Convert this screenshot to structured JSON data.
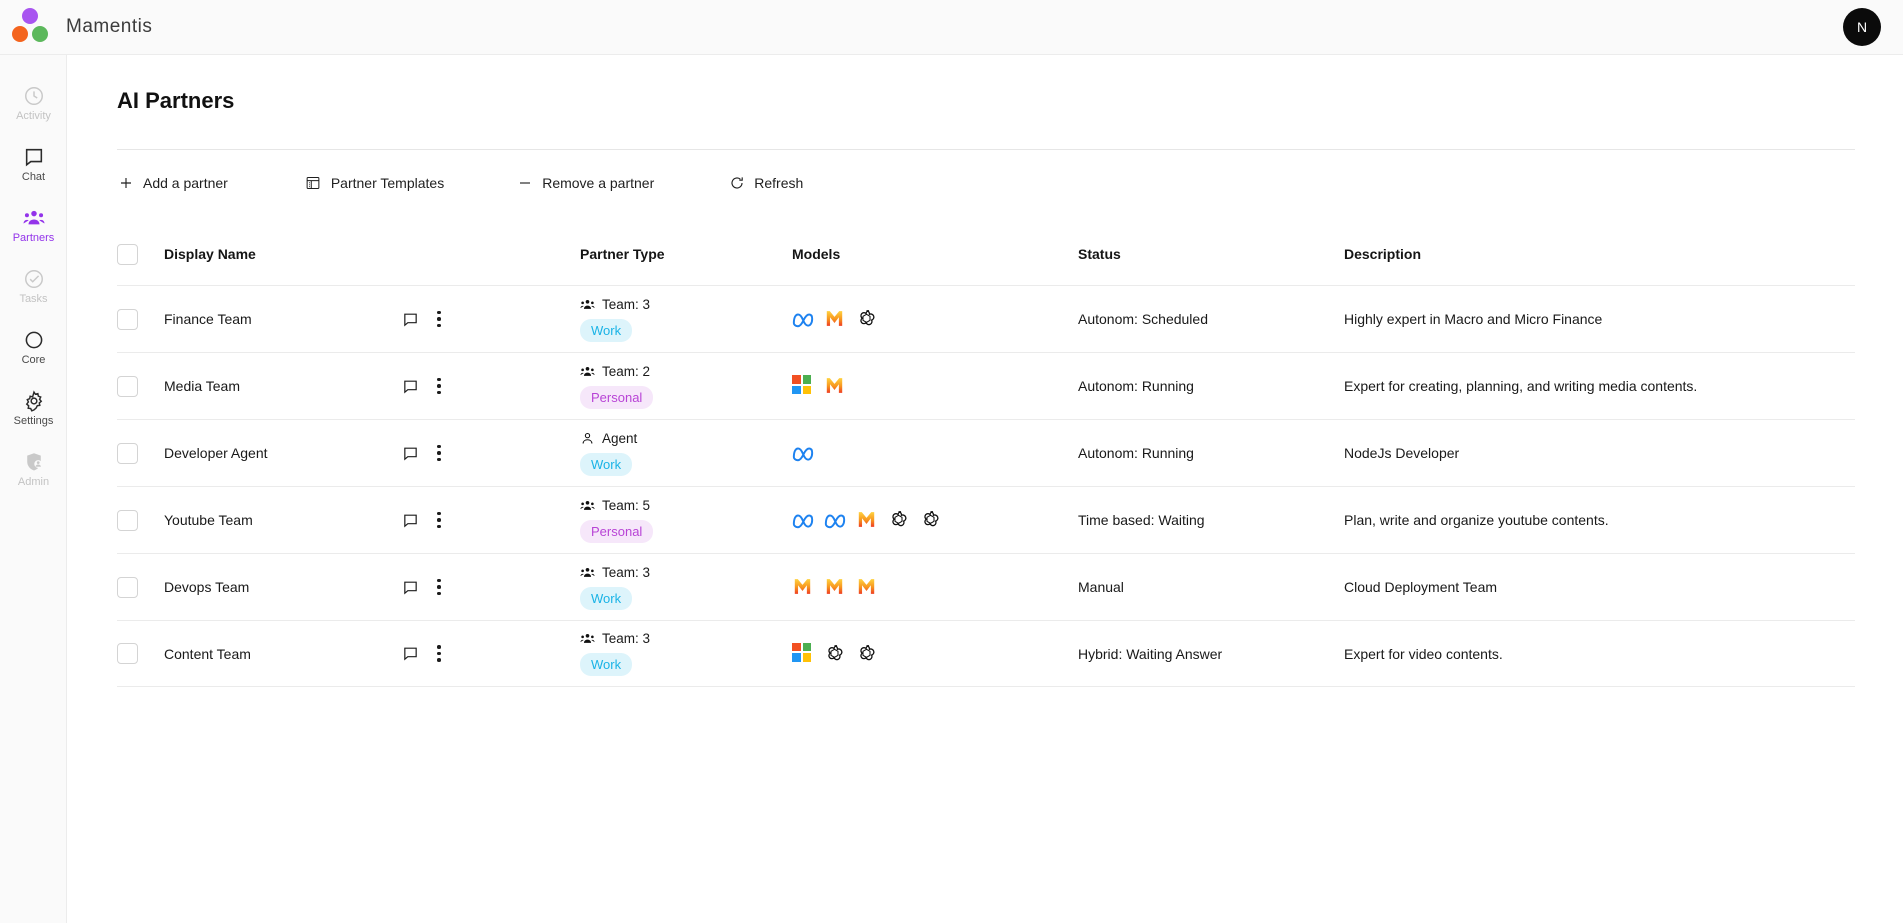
{
  "app": {
    "brand": "Mamentis",
    "logo_colors": {
      "purple": "#a855f0",
      "orange": "#f4641e",
      "green": "#5cb85c"
    },
    "avatar_initial": "N"
  },
  "sidebar": {
    "items": [
      {
        "label": "Activity",
        "icon": "clock-icon",
        "state": "dim"
      },
      {
        "label": "Chat",
        "icon": "chat-bubble-icon",
        "state": "normal"
      },
      {
        "label": "Partners",
        "icon": "people-icon",
        "state": "active"
      },
      {
        "label": "Tasks",
        "icon": "check-circle-icon",
        "state": "dim"
      },
      {
        "label": "Core",
        "icon": "circle-icon",
        "state": "normal"
      },
      {
        "label": "Settings",
        "icon": "gear-icon",
        "state": "normal"
      },
      {
        "label": "Admin",
        "icon": "shield-user-icon",
        "state": "dim"
      }
    ],
    "active_color": "#9333ea"
  },
  "page": {
    "title": "AI Partners"
  },
  "toolbar": {
    "add_label": "Add a partner",
    "templates_label": "Partner Templates",
    "remove_label": "Remove a partner",
    "refresh_label": "Refresh"
  },
  "table": {
    "columns": [
      "Display Name",
      "Partner Type",
      "Models",
      "Status",
      "Description"
    ],
    "rows": [
      {
        "display_name": "Finance Team",
        "type_label": "Team: 3",
        "type_icon": "people-icon",
        "badge": "Work",
        "badge_kind": "work",
        "models": [
          "meta",
          "gmail",
          "openai"
        ],
        "status": "Autonom: Scheduled",
        "description": "Highly expert in Macro and Micro Finance"
      },
      {
        "display_name": "Media Team",
        "type_label": "Team: 2",
        "type_icon": "people-icon",
        "badge": "Personal",
        "badge_kind": "personal",
        "models": [
          "microsoft",
          "gmail"
        ],
        "status": "Autonom: Running",
        "description": "Expert for creating, planning, and writing media contents."
      },
      {
        "display_name": "Developer Agent",
        "type_label": "Agent",
        "type_icon": "person-icon",
        "badge": "Work",
        "badge_kind": "work",
        "models": [
          "meta"
        ],
        "status": "Autonom: Running",
        "description": "NodeJs Developer"
      },
      {
        "display_name": "Youtube Team",
        "type_label": "Team: 5",
        "type_icon": "people-icon",
        "badge": "Personal",
        "badge_kind": "personal",
        "models": [
          "meta",
          "meta",
          "gmail",
          "openai",
          "openai"
        ],
        "status": "Time based: Waiting",
        "description": "Plan, write and organize youtube contents."
      },
      {
        "display_name": "Devops Team",
        "type_label": "Team: 3",
        "type_icon": "people-icon",
        "badge": "Work",
        "badge_kind": "work",
        "models": [
          "gmail",
          "gmail",
          "gmail"
        ],
        "status": "Manual",
        "description": "Cloud Deployment Team"
      },
      {
        "display_name": "Content Team",
        "type_label": "Team: 3",
        "type_icon": "people-icon",
        "badge": "Work",
        "badge_kind": "work",
        "models": [
          "microsoft",
          "openai",
          "openai"
        ],
        "status": "Hybrid: Waiting Answer",
        "description": "Expert for video contents."
      }
    ]
  },
  "colors": {
    "badge_work_bg": "#ddf4fb",
    "badge_work_fg": "#1ab3e6",
    "badge_personal_bg": "#f6e7fa",
    "badge_personal_fg": "#b844d6",
    "meta_blue": "#1d82f0",
    "microsoft_red": "#f25022",
    "microsoft_green": "#4caf50",
    "microsoft_blue": "#2196f3",
    "microsoft_yellow": "#ffc107",
    "gmail_orange": "#f7941e"
  }
}
